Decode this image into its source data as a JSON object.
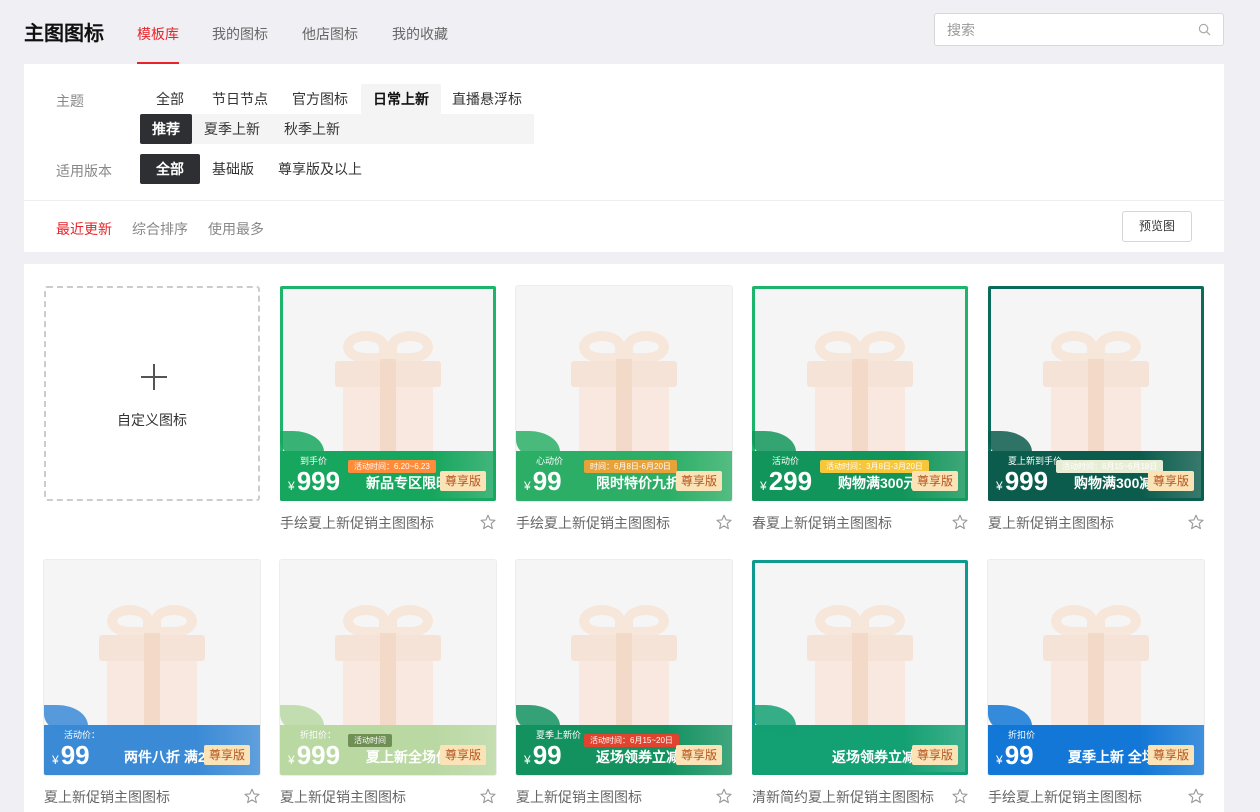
{
  "header": {
    "title": "主图图标",
    "tabs": [
      "模板库",
      "我的图标",
      "他店图标",
      "我的收藏"
    ],
    "search_placeholder": "搜索"
  },
  "filters": {
    "theme_label": "主题",
    "themes": [
      "全部",
      "节日节点",
      "官方图标",
      "日常上新",
      "直播悬浮标"
    ],
    "selected_theme": "日常上新",
    "subthemes": [
      "推荐",
      "夏季上新",
      "秋季上新"
    ],
    "selected_subtheme": "推荐",
    "version_label": "适用版本",
    "versions": [
      "全部",
      "基础版",
      "尊享版及以上"
    ],
    "selected_version": "全部"
  },
  "sort": {
    "options": [
      "最近更新",
      "综合排序",
      "使用最多"
    ],
    "active": "最近更新",
    "preview_label": "预览图"
  },
  "custom_card": {
    "label": "自定义图标"
  },
  "cards": [
    {
      "name": "手绘夏上新促销主图图标",
      "price_label": "到手价",
      "price": "999",
      "time": "活动时间：6.20~6.23",
      "slogan": "新品专区限时",
      "vip": "尊享版",
      "band_color": "#17a65e",
      "accent": "#ff8c3a"
    },
    {
      "name": "手绘夏上新促销主图图标",
      "price_label": "心动价",
      "price": "99",
      "time": "时间：6月8日-6月20日",
      "slogan": "限时特价九折",
      "vip": "尊享版",
      "band_color": "#2cae66",
      "accent": "#e8a23a"
    },
    {
      "name": "春夏上新促销主图图标",
      "price_label": "活动价",
      "price": "299",
      "time": "活动时间：3月8日-3月20日",
      "slogan": "购物满300元减",
      "vip": "尊享版",
      "band_color": "#12955a",
      "accent": "#f6c63b"
    },
    {
      "name": "夏上新促销主图图标",
      "price_label": "夏上新到手价",
      "price": "999",
      "time": "活动时间：6月15~6月18日",
      "slogan": "购物满300减30",
      "vip": "尊享版",
      "band_color": "#0b5c4c",
      "accent": "#e8edd6"
    },
    {
      "name": "夏上新促销主图图标",
      "price_label": "活动价：",
      "price": "99",
      "time": "",
      "slogan": "两件八折 满20",
      "vip": "尊享版",
      "band_color": "#3a8ad6",
      "accent": "#e8cc7a"
    },
    {
      "name": "夏上新促销主图图标",
      "price_label": "折扣价：",
      "price": "999",
      "time": "活动时间",
      "slogan": "夏上新全场优惠",
      "vip": "尊享版",
      "band_color": "#b9d8a2",
      "accent": "#6f8f55"
    },
    {
      "name": "夏上新促销主图图标",
      "price_label": "夏季上新价",
      "price": "99",
      "time": "活动时间：6月15~20日",
      "slogan": "返场领券立减",
      "vip": "尊享版",
      "band_color": "#139260",
      "accent": "#e0442f"
    },
    {
      "name": "清新简约夏上新促销主图图标",
      "price_label": "",
      "price": "",
      "time": "",
      "slogan": "返场领券立减10元",
      "vip": "尊享版",
      "band_color": "#13a072",
      "accent": "#ffffff"
    },
    {
      "name": "手绘夏上新促销主图图标",
      "price_label": "折扣价",
      "price": "99",
      "time": "",
      "slogan": "夏季上新 全场",
      "vip": "尊享版",
      "band_color": "#1277d6",
      "accent": "#ff8a2a"
    }
  ]
}
